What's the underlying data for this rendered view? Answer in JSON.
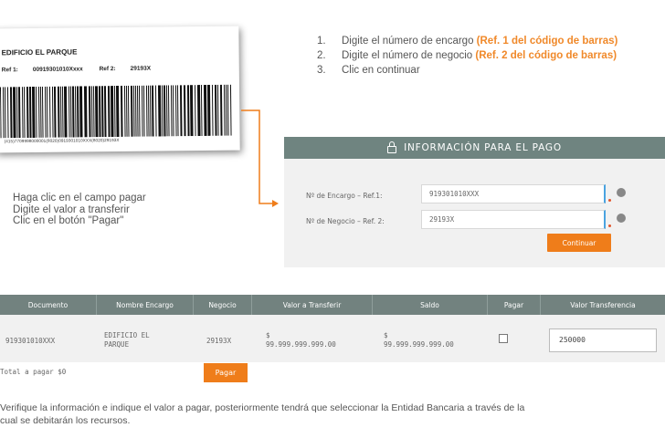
{
  "barcode_card": {
    "company": "EDIFICIO EL PARQUE",
    "ref1_label": "Ref 1:",
    "ref1_value": "00919301010Xxxx",
    "ref2_label": "Ref 2:",
    "ref2_value": "29193X",
    "number_line": "(415)7709998000001(8020)0919301010XXX(8020)29193X"
  },
  "steps": [
    {
      "num": "1.",
      "text": "Digite el número de encargo ",
      "highlight": "(Ref. 1 del código de barras)"
    },
    {
      "num": "2.",
      "text": "Digite el número de negocio ",
      "highlight": "(Ref. 2 del código de barras)"
    },
    {
      "num": "3.",
      "text": "Clic en continuar",
      "highlight": ""
    }
  ],
  "left_instructions": [
    "Haga clic en el campo pagar",
    "Digite el valor a transferir",
    "Clic en el botón \"Pagar\""
  ],
  "payment_panel": {
    "title": "INFORMACIÓN PARA EL PAGO",
    "encargo_label": "Nº de Encargo – Ref.1:",
    "encargo_value": "919301010XXX",
    "negocio_label": "Nº de Negocio – Ref. 2:",
    "negocio_value": "29193X",
    "continue_label": "Continuar"
  },
  "table": {
    "headers": [
      "Documento",
      "Nombre Encargo",
      "Negocio",
      "Valor a Transferir",
      "Saldo",
      "Pagar",
      "Valor Transferencia"
    ],
    "row": {
      "documento": "919301010XXX",
      "nombre_1": "EDIFICIO EL",
      "nombre_2": "PARQUE",
      "negocio": "29193X",
      "valor_1": "$",
      "valor_2": "99.999.999.999.00",
      "saldo_1": "$",
      "saldo_2": "99.999.999.999.00",
      "transferencia": "250000"
    },
    "total_label": "Total a pagar  $0",
    "pay_label": "Pagar"
  },
  "footnote": {
    "line1": "Verifique la información e indique el valor a pagar, posteriormente tendrá que seleccionar la Entidad Bancaria a través de la",
    "line2": "cual se debitarán los recursos."
  },
  "colors": {
    "accent": "#ef7d1a",
    "header": "#6f8480",
    "highlight": "#f0892a"
  }
}
